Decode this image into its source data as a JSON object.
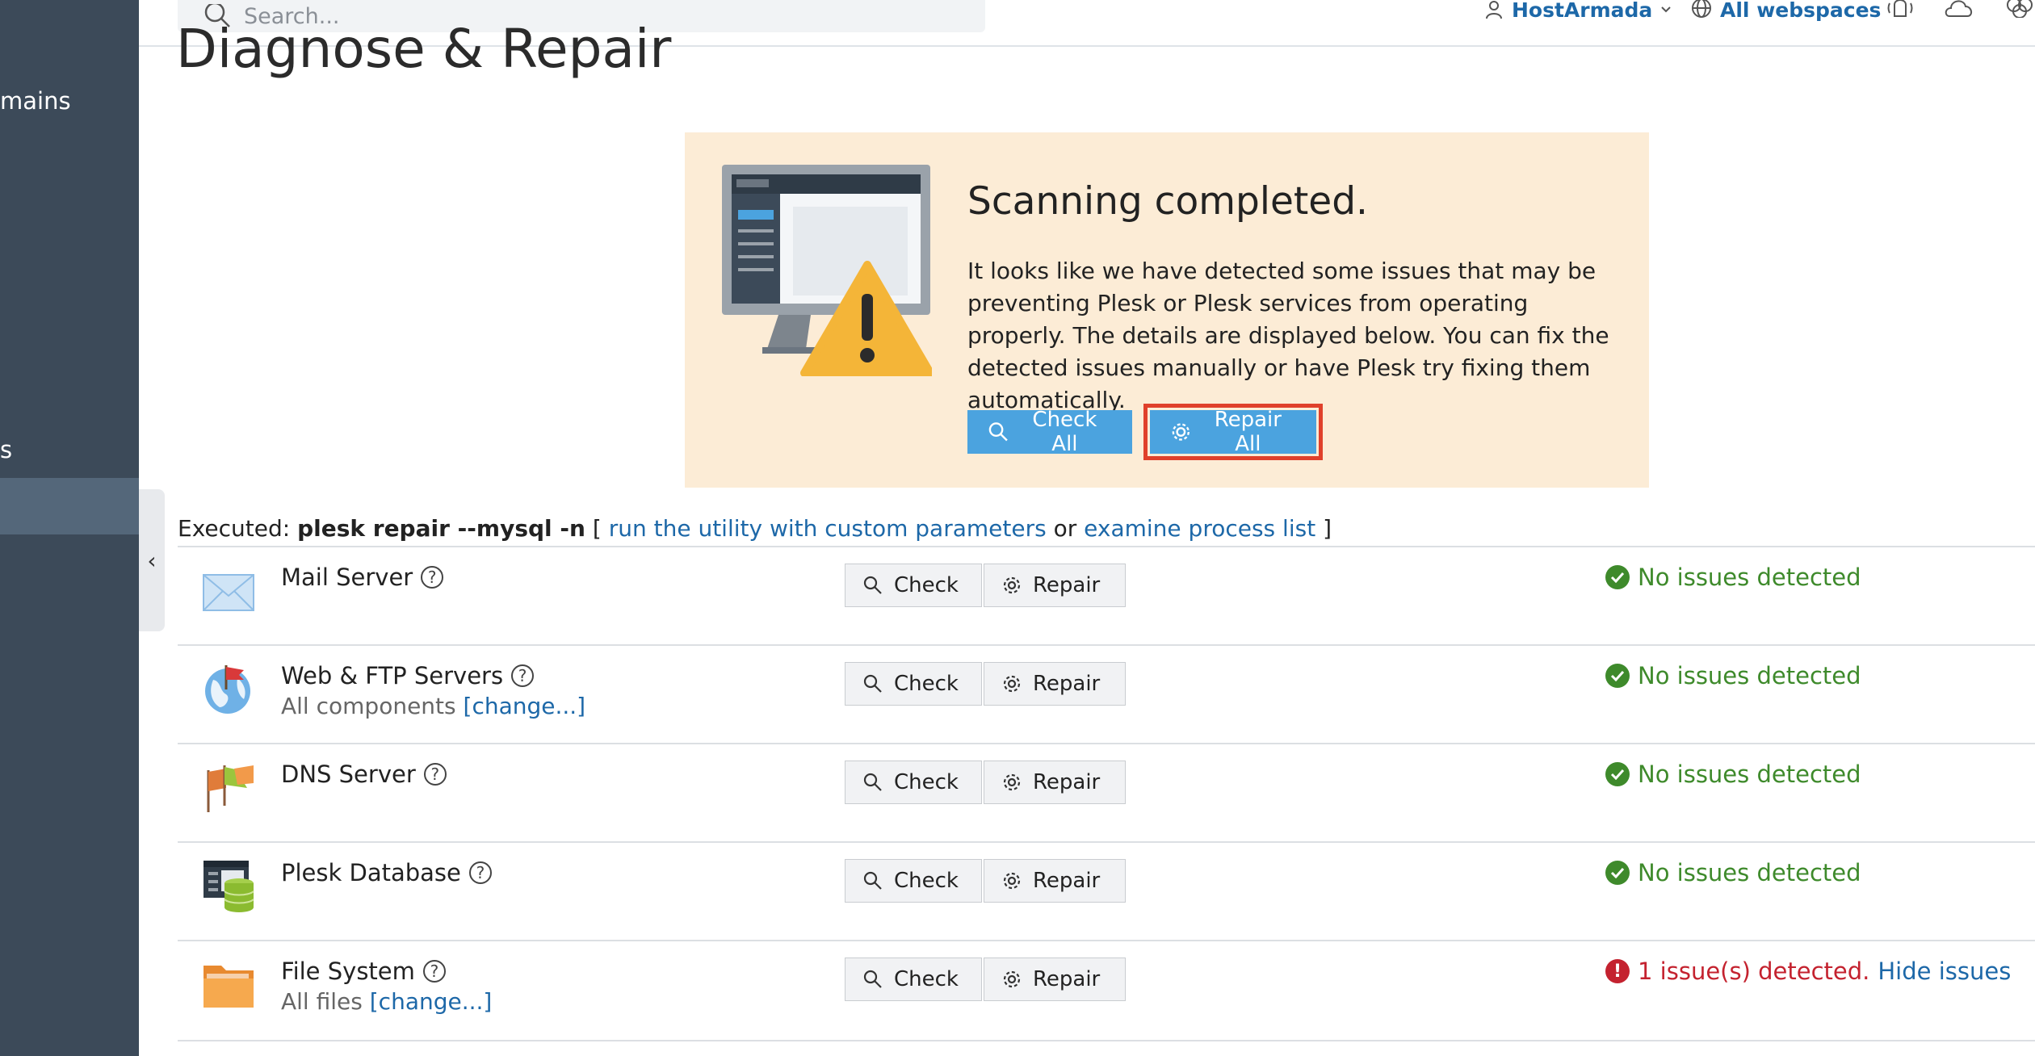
{
  "sidebar": {
    "items": [
      {
        "label": "mains"
      },
      {
        "label": "s"
      }
    ],
    "collapse_glyph": "‹"
  },
  "header": {
    "search_placeholder": "Search...",
    "account_label": "HostArmada",
    "webspaces_label": "All webspaces"
  },
  "page": {
    "title": "Diagnose & Repair"
  },
  "scan": {
    "title": "Scanning completed.",
    "message": "It looks like we have detected some issues that may be preventing Plesk or Plesk services from operating properly. The details are displayed below. You can fix the detected issues manually or have Plesk try fixing them automatically.",
    "check_all_label": "Check All",
    "repair_all_label": "Repair All"
  },
  "executed": {
    "prefix": "Executed:",
    "command": "plesk repair --mysql -n",
    "open_bracket": "[",
    "link_custom": "run the utility with custom parameters",
    "or_text": "or",
    "link_process": "examine process list",
    "close_bracket": "]"
  },
  "rows": [
    {
      "name": "Mail Server",
      "sub": "",
      "sub_link": "",
      "status": "No issues detected",
      "status_type": "ok",
      "status_link": ""
    },
    {
      "name": "Web & FTP Servers",
      "sub": "All components",
      "sub_link": "[change...]",
      "status": "No issues detected",
      "status_type": "ok",
      "status_link": ""
    },
    {
      "name": "DNS Server",
      "sub": "",
      "sub_link": "",
      "status": "No issues detected",
      "status_type": "ok",
      "status_link": ""
    },
    {
      "name": "Plesk Database",
      "sub": "",
      "sub_link": "",
      "status": "No issues detected",
      "status_type": "ok",
      "status_link": ""
    },
    {
      "name": "File System",
      "sub": "All files",
      "sub_link": "[change...]",
      "status": "1 issue(s) detected.",
      "status_type": "error",
      "status_link": "Hide issues"
    }
  ],
  "row_buttons": {
    "check_label": "Check",
    "repair_label": "Repair"
  },
  "help_glyph": "?",
  "colors": {
    "sidebar_bg": "#3c4a59",
    "accent_blue": "#4ba3df",
    "link_blue": "#1d68a8",
    "panel_bg": "#fcecd6",
    "ok_green": "#3e8a2b",
    "error_red": "#c4222f",
    "highlight_red": "#e0402b"
  },
  "icons": {
    "search": "search-icon",
    "user": "user-icon",
    "globe": "globe-icon",
    "bell": "bell-icon",
    "cloud": "cloud-icon",
    "gear": "gear-icon",
    "check_circle": "check-circle-icon",
    "error_circle": "error-circle-icon"
  }
}
